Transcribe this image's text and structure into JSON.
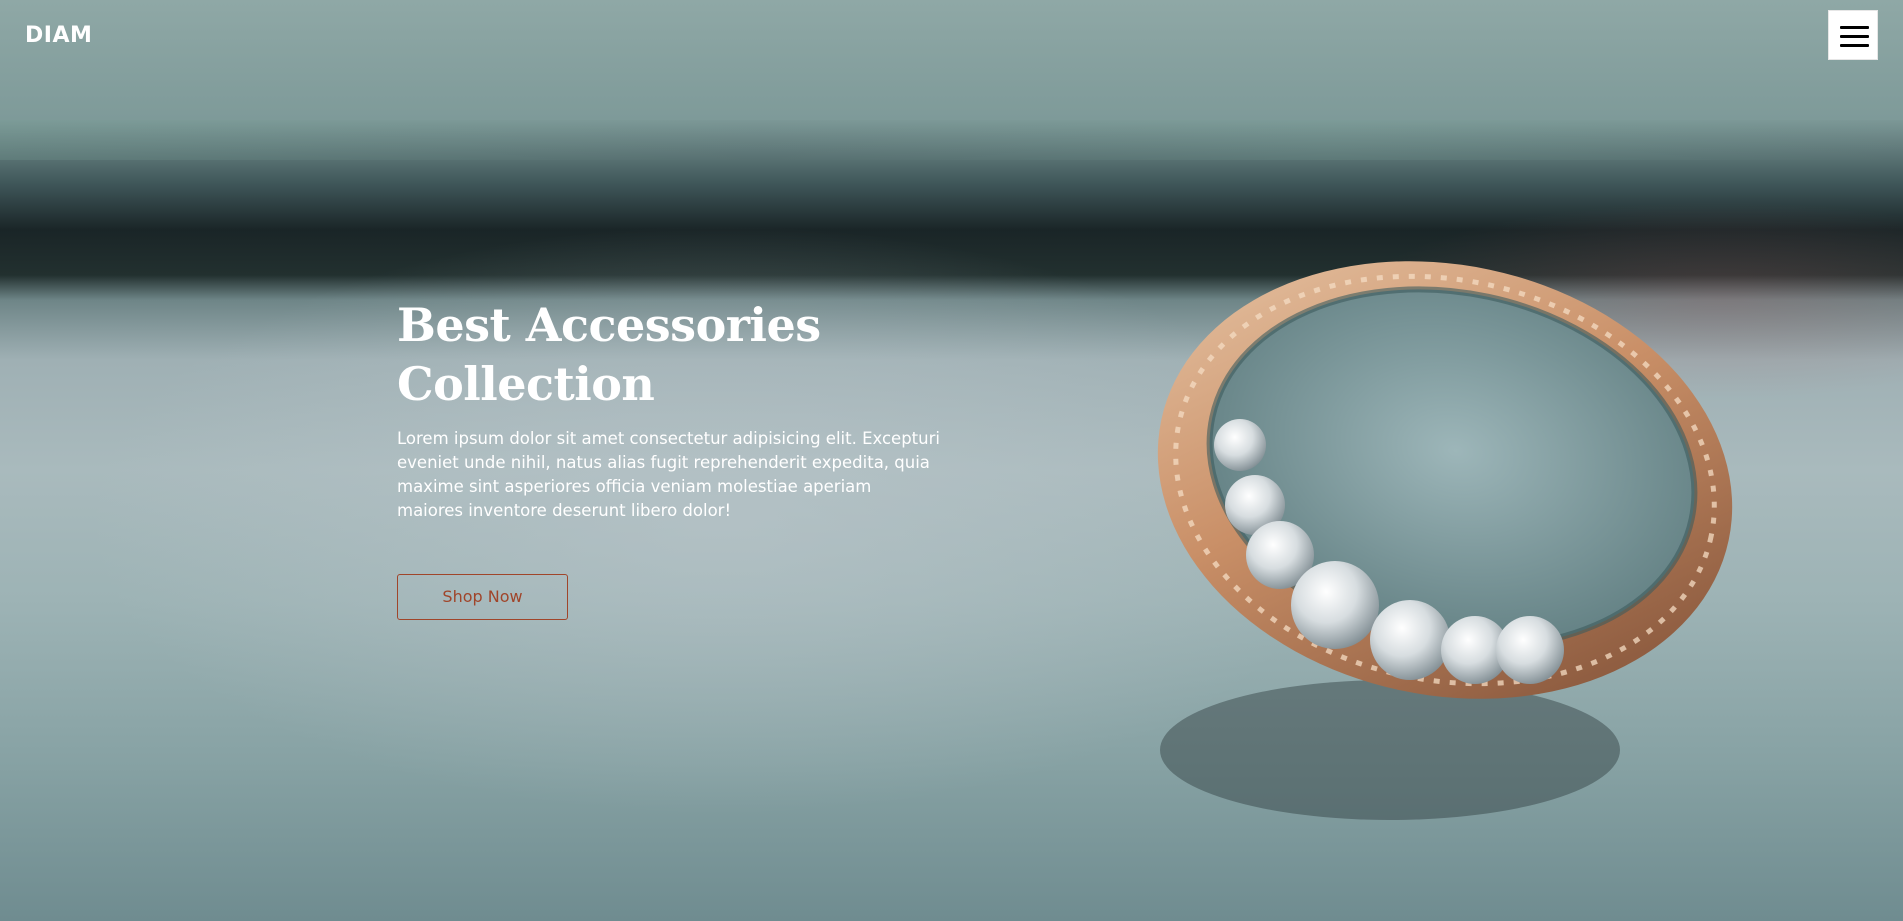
{
  "header": {
    "logo": "DIAM",
    "menu_icon": "hamburger-menu-icon"
  },
  "hero": {
    "title_line1": "Best Accessories",
    "title_line2": "Collection",
    "description": "Lorem ipsum dolor sit amet consectetur adipisicing elit. Excepturi eveniet unde nihil, natus alias fugit reprehenderit expedita, quia maxime sint asperiores officia veniam molestiae aperiam maiores inventore deserunt libero dolor!",
    "cta_label": "Shop Now"
  },
  "colors": {
    "accent": "#a0452a",
    "text": "#ffffff",
    "menu_bg": "#ffffff"
  }
}
